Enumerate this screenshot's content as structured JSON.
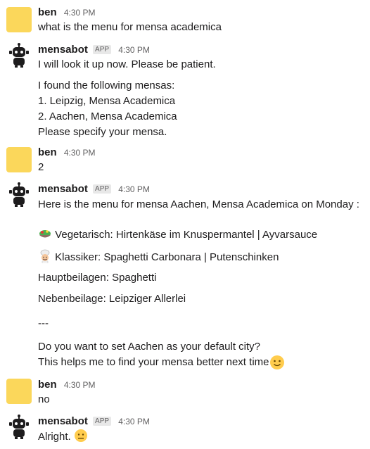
{
  "messages": [
    {
      "author": "ben",
      "time": "4:30 PM",
      "lines": [
        "what is the menu for mensa academica"
      ]
    },
    {
      "author": "mensabot",
      "badge": "APP",
      "time": "4:30 PM",
      "lines": [
        "I will look it up now. Please be patient.",
        "I found the following mensas:",
        "1. Leipzig, Mensa Academica",
        "2. Aachen, Mensa Academica",
        "Please specify your mensa."
      ]
    },
    {
      "author": "ben",
      "time": "4:30 PM",
      "lines": [
        "2"
      ]
    },
    {
      "author": "mensabot",
      "badge": "APP",
      "time": "4:30 PM",
      "lines": [
        "Here is the menu for mensa Aachen, Mensa Academica on Monday :",
        "Vegetarisch: Hirtenkäse im Knuspermantel | Ayvarsauce",
        "Klassiker: Spaghetti Carbonara | Putenschinken",
        "Hauptbeilagen: Spaghetti",
        "Nebenbeilage: Leipziger Allerlei",
        "---",
        "Do you want to set Aachen as your default city?",
        "This helps me to find your mensa better next time"
      ],
      "emojis": {
        "salad": "salad-emoji",
        "chef": "chef-emoji",
        "smile": "slightly-smiling-emoji"
      }
    },
    {
      "author": "ben",
      "time": "4:30 PM",
      "lines": [
        "no"
      ]
    },
    {
      "author": "mensabot",
      "badge": "APP",
      "time": "4:30 PM",
      "lines": [
        "Alright."
      ],
      "emojis": {
        "neutral": "neutral-face-emoji"
      }
    }
  ],
  "colors": {
    "user_avatar": "#fbd75b",
    "bot_avatar": "#1d1c1d",
    "text": "#1d1c1d",
    "muted": "#616061"
  }
}
